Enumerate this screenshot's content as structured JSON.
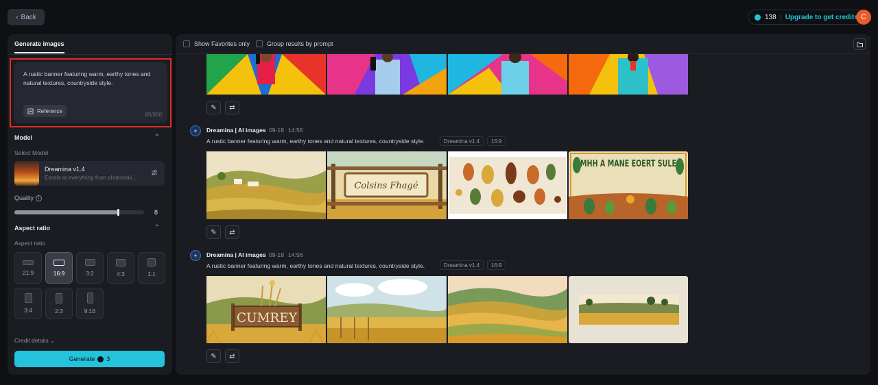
{
  "header": {
    "back_label": "Back",
    "credit_count": "138",
    "upgrade_label": "Upgrade to get credits",
    "avatar_letter": "C"
  },
  "sidebar": {
    "tab_label": "Generate images",
    "prompt_text": "A rustic banner featuring warm, earthy tones and natural textures, countryside style.",
    "reference_label": "Reference",
    "char_count": "85/800",
    "model_section_label": "Model",
    "select_model_label": "Select Model",
    "model_name": "Dreamina v1.4",
    "model_desc": "Excels at everything from photoreali...",
    "quality_label": "Quality",
    "quality_value": "8",
    "quality_fraction": 0.8,
    "aspect_section_label": "Aspect ratio",
    "aspect_sub_label": "Aspect ratio",
    "ratios": [
      "21:9",
      "16:9",
      "3:2",
      "4:3",
      "1:1",
      "3:4",
      "2:3",
      "9:16"
    ],
    "selected_ratio": "16:9",
    "credit_details_label": "Credit details",
    "generate_label": "Generate",
    "generate_cost": "3"
  },
  "toolbar": {
    "favorites_label": "Show Favorites only",
    "group_label": "Group results by prompt"
  },
  "groups": [
    {
      "title": "Dreamina | AI images",
      "date": "09-18",
      "time": "14:56",
      "prompt": "A rustic banner featuring warm, earthy tones and natural textures, countryside style.",
      "model": "Dreamina v1.4",
      "ratio": "16:9"
    },
    {
      "title": "Dreamina | AI images",
      "date": "09-18",
      "time": "14:56",
      "prompt": "A rustic banner featuring warm, earthy tones and natural textures, countryside style.",
      "model": "Dreamina v1.4",
      "ratio": "16:9"
    }
  ],
  "image_text": {
    "banner_sign": "Colsins Fhagé",
    "banner_poster": "MHH A MANE EOERT SULE",
    "banner_cumrey": "CUMREY"
  },
  "colors": {
    "accent": "#23c3dc",
    "highlight_border": "#e12b2b"
  }
}
